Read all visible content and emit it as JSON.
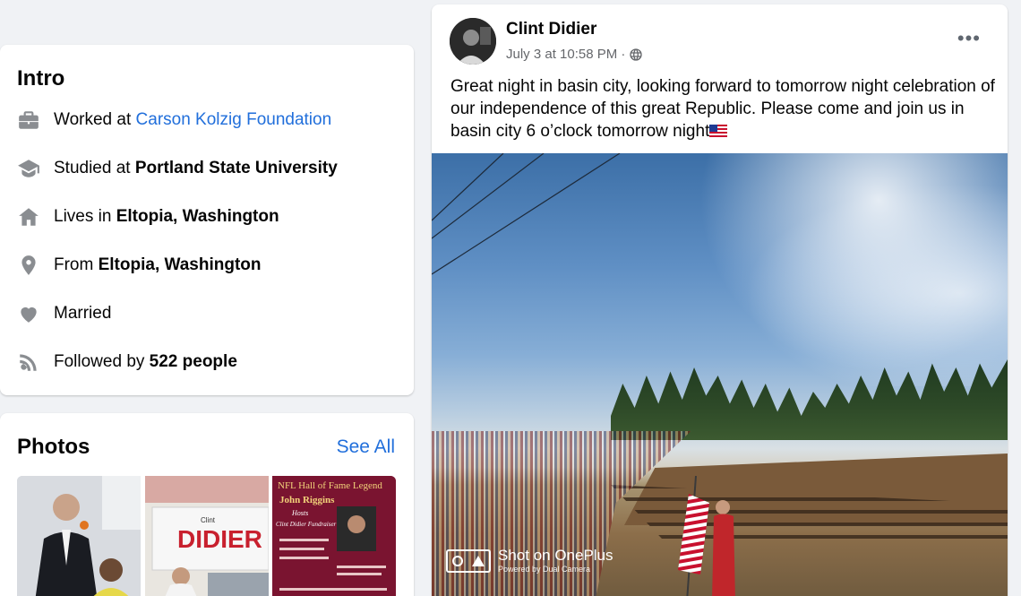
{
  "intro": {
    "title": "Intro",
    "rows": [
      {
        "icon": "briefcase-icon",
        "prefix": "Worked at ",
        "value": "Carson Kolzig Foundation",
        "link": true
      },
      {
        "icon": "graduation-cap-icon",
        "prefix": "Studied at ",
        "value": "Portland State University",
        "link": false
      },
      {
        "icon": "home-icon",
        "prefix": "Lives in ",
        "value": "Eltopia, Washington",
        "link": false
      },
      {
        "icon": "location-pin-icon",
        "prefix": "From ",
        "value": "Eltopia, Washington",
        "link": false
      },
      {
        "icon": "heart-icon",
        "prefix": "Married",
        "value": "",
        "link": false
      },
      {
        "icon": "rss-icon",
        "prefix": "Followed by ",
        "value": "522 people",
        "link": false
      }
    ]
  },
  "photos": {
    "title": "Photos",
    "see_all": "See All",
    "thumb2_text": "DIDIER",
    "thumb2_small": "Clint",
    "thumb3_title": "NFL Hall of Fame Legend",
    "thumb3_name": "John Riggins",
    "thumb3_hosts": "Hosts",
    "thumb3_event": "Clint Didier Fundraiser"
  },
  "post": {
    "author": "Clint Didier",
    "timestamp": "July 3 at 10:58 PM ·",
    "more": "•••",
    "text": "Great night in basin city, looking forward to tomorrow night celebration of our independence of this great Republic.   Please come and join us in basin city 6 o’clock tomorrow night",
    "watermark_title": "Shot on OnePlus",
    "watermark_sub": "Powered by Dual Camera"
  }
}
